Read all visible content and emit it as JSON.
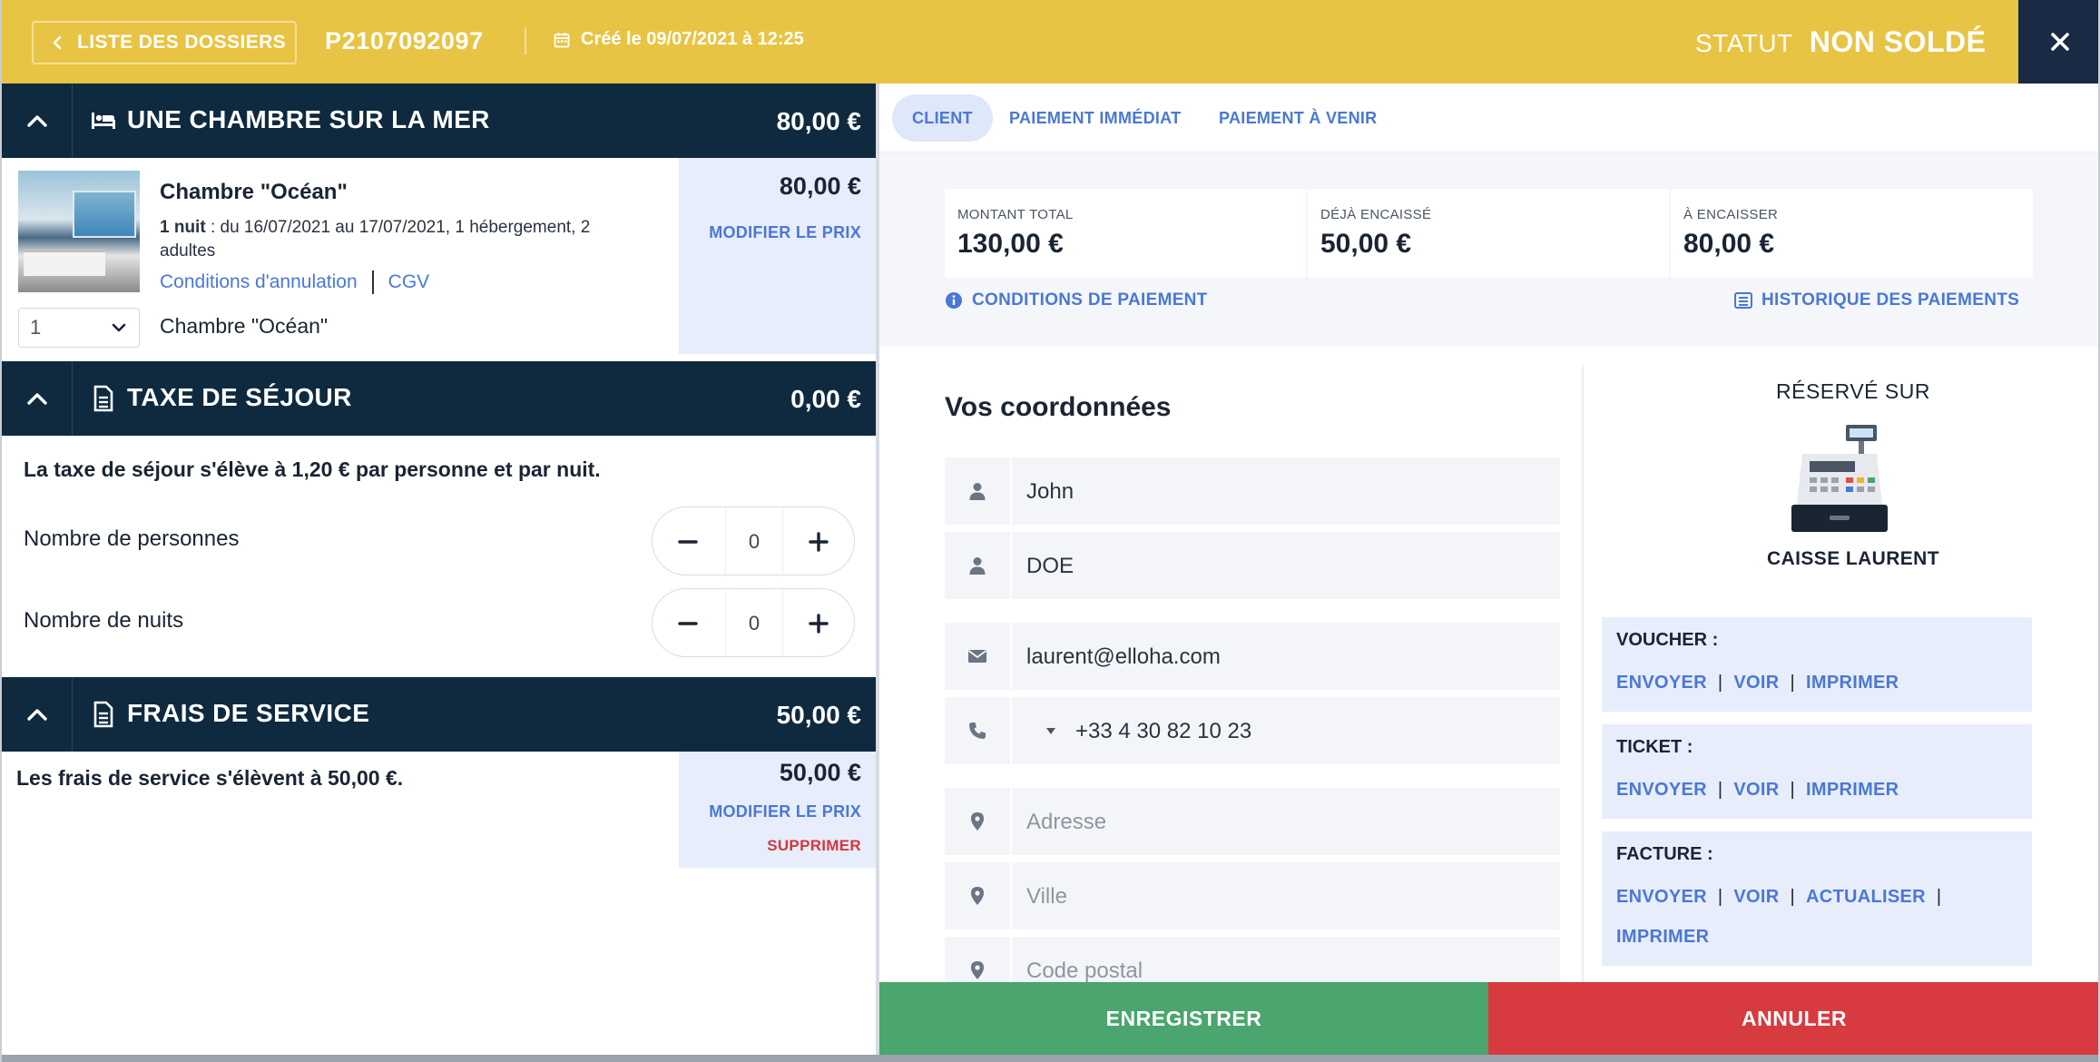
{
  "header": {
    "back_label": "LISTE DES DOSSIERS",
    "dossier_number": "P2107092097",
    "created": "Créé le 09/07/2021 à 12:25",
    "status_label": "STATUT",
    "status_value": "NON SOLDÉ",
    "accent": "#e8c444"
  },
  "left": {
    "room_section": {
      "title": "UNE CHAMBRE SUR LA MER",
      "price": "80,00 €",
      "room_name": "Chambre \"Océan\"",
      "nights_bold": "1 nuit",
      "details": " : du 16/07/2021 au 17/07/2021, 1 hébergement, 2 adultes",
      "cancel_link": "Conditions d'annulation",
      "cgv_link": "CGV",
      "qty": "1",
      "room_label": "Chambre \"Océan\"",
      "line_price": "80,00 €",
      "modify_price": "MODIFIER LE PRIX"
    },
    "tax_section": {
      "title": "TAXE DE SÉJOUR",
      "price": "0,00 €",
      "info": "La taxe de séjour s'élève à 1,20 € par personne et par nuit.",
      "persons_label": "Nombre de personnes",
      "persons_value": "0",
      "nights_label": "Nombre de nuits",
      "nights_value": "0"
    },
    "fees_section": {
      "title": "FRAIS DE SERVICE",
      "price": "50,00 €",
      "info": "Les frais de service s'élèvent à 50,00 €.",
      "line_price": "50,00 €",
      "modify_price": "MODIFIER LE PRIX",
      "delete": "SUPPRIMER"
    }
  },
  "right": {
    "tabs": [
      {
        "label": "CLIENT",
        "active": true
      },
      {
        "label": "PAIEMENT IMMÉDIAT",
        "active": false
      },
      {
        "label": "PAIEMENT À VENIR",
        "active": false
      }
    ],
    "amounts": [
      {
        "label": "MONTANT TOTAL",
        "value": "130,00 €"
      },
      {
        "label": "DÉJÀ ENCAISSÉ",
        "value": "50,00 €"
      },
      {
        "label": "À ENCAISSER",
        "value": "80,00 €"
      }
    ],
    "payment_conditions": "CONDITIONS DE PAIEMENT",
    "payment_history": "HISTORIQUE DES PAIEMENTS",
    "form": {
      "title": "Vos coordonnées",
      "first_name": "John",
      "last_name": "DOE",
      "email": "laurent@elloha.com",
      "phone": "+33 4 30 82 10 23",
      "address_placeholder": "Adresse",
      "city_placeholder": "Ville",
      "postal_placeholder": "Code postal"
    },
    "booked_on": {
      "title": "RÉSERVÉ SUR",
      "source": "CAISSE LAURENT"
    },
    "voucher": {
      "label": "VOUCHER :",
      "send": "ENVOYER",
      "view": "VOIR",
      "print": "IMPRIMER"
    },
    "ticket": {
      "label": "TICKET :",
      "send": "ENVOYER",
      "view": "VOIR",
      "print": "IMPRIMER"
    },
    "invoice": {
      "label": "FACTURE :",
      "send": "ENVOYER",
      "view": "VOIR",
      "update": "ACTUALISER",
      "print": "IMPRIMER"
    }
  },
  "actions": {
    "save": "ENREGISTRER",
    "cancel": "ANNULER",
    "save_color": "#4aa56e",
    "cancel_color": "#d73a3f"
  }
}
